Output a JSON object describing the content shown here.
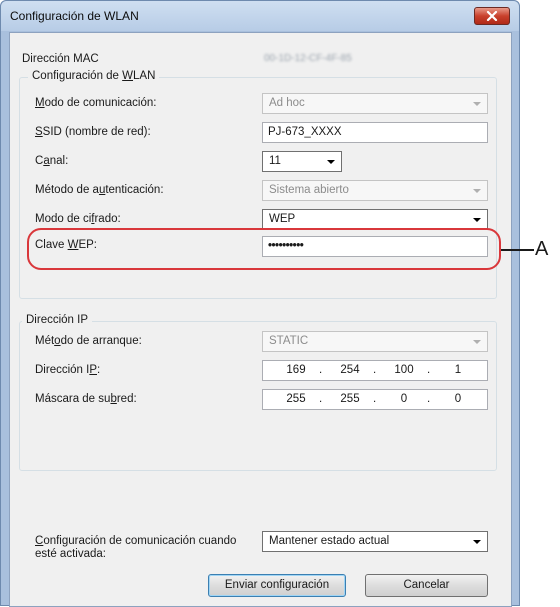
{
  "window": {
    "title": "Configuración de WLAN"
  },
  "mac": {
    "label": "Dirección MAC",
    "value": "00-1D-12-CF-4F-85"
  },
  "wlan": {
    "group_label": "Configuración de ",
    "group_label_u": "W",
    "group_label_rest": "LAN",
    "mode_label_u": "M",
    "mode_label_rest": "odo de comunicación:",
    "mode_value": "Ad hoc",
    "ssid_label_u": "S",
    "ssid_label_rest": "SID (nombre de red):",
    "ssid_value": "PJ-673_XXXX",
    "channel_label_a": "C",
    "channel_label_u": "a",
    "channel_label_rest": "nal:",
    "channel_value": "11",
    "auth_label_a": "Método de a",
    "auth_label_u": "u",
    "auth_label_rest": "tenticación:",
    "auth_value": "Sistema abierto",
    "cipher_label_a": "Modo de ci",
    "cipher_label_u": "f",
    "cipher_label_rest": "rado:",
    "cipher_value": "WEP",
    "wep_label_a": "Clave ",
    "wep_label_u": "W",
    "wep_label_rest": "EP:",
    "wep_value": "••••••••••"
  },
  "ip": {
    "group_label": "Dirección IP",
    "boot_label_a": "Mét",
    "boot_label_u": "o",
    "boot_label_rest": "do de arranque:",
    "boot_value": "STATIC",
    "addr_label_a": "Dirección I",
    "addr_label_u": "P",
    "addr_label_rest": ":",
    "address": [
      "169",
      "254",
      "100",
      "1"
    ],
    "mask_label_a": "Máscara de su",
    "mask_label_u": "b",
    "mask_label_rest": "red:",
    "mask": [
      "255",
      "255",
      "0",
      "0"
    ]
  },
  "comm": {
    "label_u": "C",
    "label_line1_rest": "onfiguración de comunicación cuando",
    "label_line2": "esté activada:",
    "value": "Mantener estado actual"
  },
  "buttons": {
    "send": "Enviar configuración",
    "cancel": "Cancelar"
  },
  "annotation": {
    "letter": "A",
    "color": "#d9373b"
  }
}
